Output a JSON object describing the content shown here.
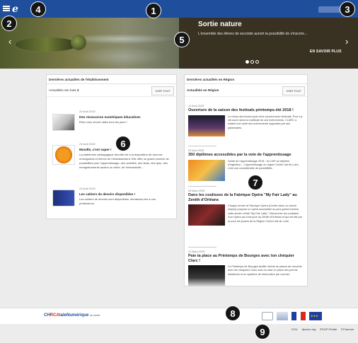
{
  "topbar": {
    "brand": "e"
  },
  "hero": {
    "title": "Sortie nature",
    "text": "L'ensemble des élèves de seconde auront la possibilité de s'inscrire...",
    "more_label": "EN SAVOIR PLUS",
    "prev_icon": "‹",
    "next_icon": "›",
    "slides": 3,
    "active_slide": 1
  },
  "left_panel": {
    "header": "Dernières actualités de l'établissement",
    "unread_label": "Actualités non lues",
    "unread_count": "3",
    "see_all": "VOIR TOUT",
    "items": [
      {
        "date": "24 Août 2018",
        "title": "Des ressources numériques éducatives",
        "desc": "Elles vous seront utiles tous les jours !"
      },
      {
        "date": "24 Août 2018",
        "title": "Moodle, c'est super !",
        "desc": "La plateforme pédagogique Moodle est à la disposition de tous les enseignants et élèves de l'établissement. Elle offre un grand nombre de possibilités pour l'apprentissage, des activités, des tests, des quiz, des enregistrements audios ou vidéo, de l'interactivité, ..."
      },
      {
        "date": "24 Août 2018",
        "title": "Les cahiers de devoirs disponibles !",
        "desc": "Les cahiers de devoirs sont disponibles, demandez-les à vos professeurs."
      }
    ]
  },
  "right_panel": {
    "header": "Dernières actualités en Région",
    "sub_label": "Actualités en Région",
    "see_all": "VOIR TOUT",
    "news": [
      {
        "date": "12 Avril 2018",
        "title": "Ouverture de la saison des festivals printemps-été 2018 !",
        "desc": "Le retour des beaux jours rime souvent avec festivals. Pour s'y retrouver dans la multitude de ces événements, CLARC a réalisé une carte des événements organisés par ses partenaires."
      },
      {
        "date": "03 Avril 2018",
        "title": "350 diplômes accessibles par la voie de l'apprentissage",
        "desc": "Guide de l'apprentissage 2018 : du CAP au diplôme d'ingénieur... L'apprentissage en région Centre-Val de Loire, c'est une considérable de possibilités."
      },
      {
        "date": "29 Mars 2018",
        "title": "Dans les coulisses de la Fabrique Opéra \"My Fair Lady\" au Zenith d'Orléans",
        "desc": "Chaque année la Fabrique Opéra (Centre dans un nouvel emploi) propose un opéra accessible au plus grand nombre, cette année c'était \"My Fair Lady\" ! Découvrez les coulisses d'un Opéra qui s'est joué au Zénith d'Orléans et qui est fait par et pour les jeunes de la Région Centre-Val de Loire."
      },
      {
        "date": "21 Mars 2018",
        "title": "Paie ta place au Printemps de Bourges avec ton chéquier Clarc !",
        "desc": "Le Printemps de Bourges facilite l'achat de places de concerts avec les chéquiers Clarc avec la mise en place des permis bédatrons et un système de réservation par courrier."
      }
    ]
  },
  "footer": {
    "logo_main": "CH",
    "logo_accent": "RCA",
    "logo_rest": "taleNumérique",
    "logo_sub": "du centre",
    "links": [
      "CGU",
      "Apereo.org",
      "ESUP-Portail",
      "©Chorcan"
    ]
  },
  "markers": [
    "1",
    "2",
    "3",
    "4",
    "5",
    "6",
    "7",
    "8",
    "9"
  ]
}
